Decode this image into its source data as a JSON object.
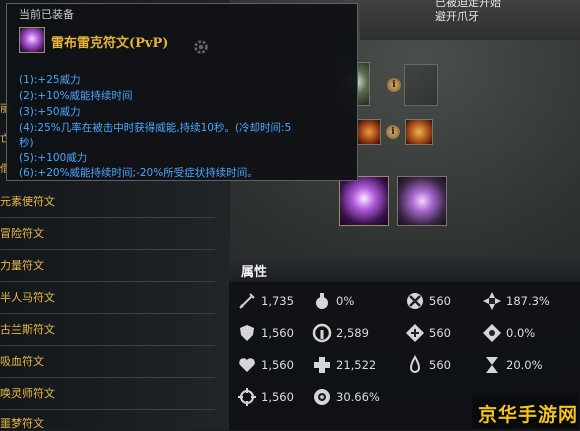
{
  "top_right": {
    "line1": "已被迫走开始",
    "line2": "避开爪牙"
  },
  "tooltip": {
    "equipped_label": "当前已装备",
    "title": "雷布雷克符文(PvP)",
    "lines": [
      "(1):+25威力",
      "(2):+10%威能持续时间",
      "(3):+50威力",
      "(4):25%几率在被击中时获得威能,持续10秒。(冷却时间:5",
      "秒)",
      "(5):+100威力",
      "(6):+20%威能持续时间;-20%所受症状持续时间。"
    ]
  },
  "left_fragments": [
    "丽",
    "亡",
    "借"
  ],
  "rune_list": [
    "元素使符文",
    "冒险符文",
    "力量符文",
    "半人马符文",
    "古兰斯符文",
    "吸血符文",
    "唤灵师符文",
    "噩梦符文"
  ],
  "attributes": {
    "title": "属性",
    "stats": [
      {
        "icon": "sword-icon",
        "value": "1,735"
      },
      {
        "icon": "potion-icon",
        "value": "0%"
      },
      {
        "icon": "crossed-circle-icon",
        "value": "560"
      },
      {
        "icon": "burst-icon",
        "value": "187.3%"
      },
      {
        "icon": "shield-icon",
        "value": "1,560"
      },
      {
        "icon": "helmet-icon",
        "value": "2,589"
      },
      {
        "icon": "diamond-cross-icon",
        "value": "560"
      },
      {
        "icon": "diamond-burst-icon",
        "value": "0.0%"
      },
      {
        "icon": "heart-icon",
        "value": "1,560"
      },
      {
        "icon": "plus-icon",
        "value": "21,522"
      },
      {
        "icon": "flame-drop-icon",
        "value": "560"
      },
      {
        "icon": "hourglass-icon",
        "value": "20.0%"
      },
      {
        "icon": "crosshair-icon",
        "value": "1,560"
      },
      {
        "icon": "gear-circle-icon",
        "value": "30.66%"
      }
    ]
  },
  "watermark": "京华手游网",
  "colors": {
    "rune_text": "#e9b84a",
    "tooltip_title": "#e6b236",
    "tooltip_stat": "#4ca6ff"
  }
}
